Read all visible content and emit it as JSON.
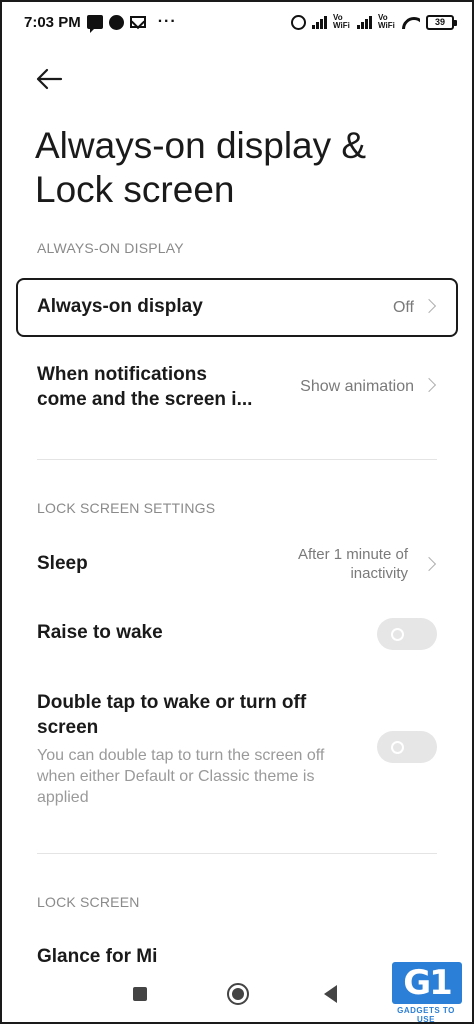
{
  "status_bar": {
    "time": "7:03 PM",
    "dots": "···",
    "volte_1": "Vo WiFi",
    "volte_2": "Vo WiFi",
    "battery": "39"
  },
  "header": {
    "title": "Always-on display & Lock screen"
  },
  "sections": {
    "aod_header": "ALWAYS-ON DISPLAY",
    "lock_settings_header": "LOCK SCREEN SETTINGS",
    "lock_screen_header": "LOCK SCREEN"
  },
  "rows": {
    "aod": {
      "title": "Always-on display",
      "value": "Off"
    },
    "notifications": {
      "title_line1": "When notifications",
      "title_line2": "come and the screen i...",
      "value": "Show animation"
    },
    "sleep": {
      "title": "Sleep",
      "value_line1": "After 1 minute of",
      "value_line2": "inactivity"
    },
    "raise_to_wake": {
      "title": "Raise to wake",
      "enabled": false
    },
    "double_tap": {
      "title_line1": "Double tap to wake or turn off",
      "title_line2": "screen",
      "sub_line1": "You can double tap to turn the screen off",
      "sub_line2": "when either Default or Classic theme is",
      "sub_line3": "applied",
      "enabled": false
    },
    "glance": {
      "title": "Glance for Mi"
    }
  },
  "watermark": {
    "logo": "G1",
    "text": "GADGETS TO USE"
  },
  "colors": {
    "accent_watermark": "#2b7fd6",
    "section_header": "#8a8a8a",
    "toggle_off": "#e6e6e6"
  }
}
